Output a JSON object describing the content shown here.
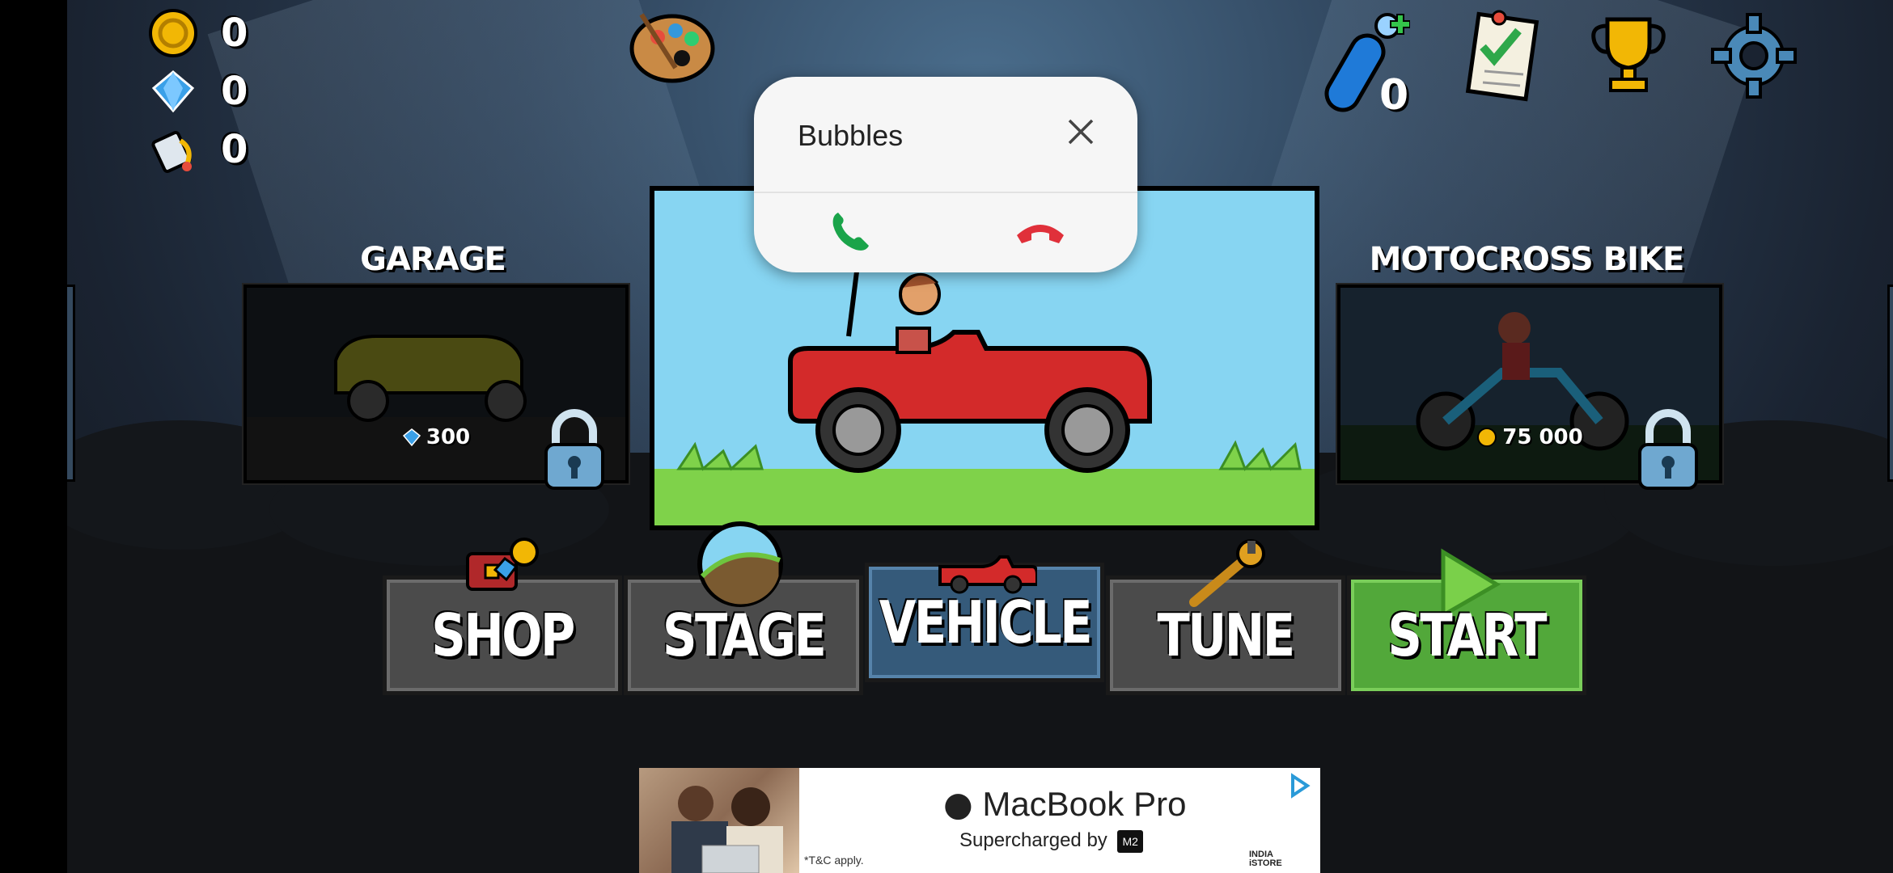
{
  "resources": {
    "coins": "0",
    "diamonds": "0",
    "paint": "0"
  },
  "top_bar": {
    "fuel_count": "0"
  },
  "vehicles": {
    "left": {
      "title": "GARAGE",
      "price": "300",
      "currency": "diamond"
    },
    "right": {
      "title": "MOTOCROSS BIKE",
      "price": "75 000",
      "currency": "coin"
    }
  },
  "tabs": {
    "shop": "SHOP",
    "stage": "STAGE",
    "vehicle": "VEHICLE",
    "tune": "TUNE",
    "start": "START"
  },
  "call": {
    "caller": "Bubbles"
  },
  "ad": {
    "title": "MacBook Pro",
    "subtitle": "Supercharged by",
    "chip": "M2",
    "terms": "*T&C apply.",
    "store_line1": "INDIA",
    "store_line2": "iSTORE"
  },
  "colors": {
    "accept": "#1aa44a",
    "decline": "#e0303a",
    "start_tab": "#52a83a",
    "vehicle_tab": "#355a7a",
    "coin": "#f2b705",
    "diamond": "#3aa0e8"
  }
}
